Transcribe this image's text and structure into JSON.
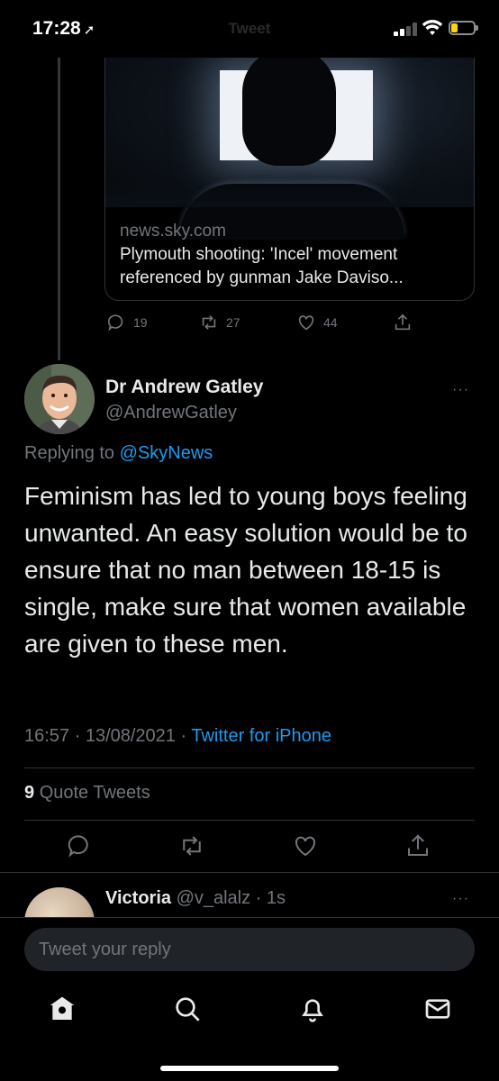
{
  "status_bar": {
    "time": "17:28",
    "location_glyph": "➚",
    "ghost_title": "Tweet",
    "battery_color": "#ffd60a"
  },
  "quoted": {
    "domain": "news.sky.com",
    "title": "Plymouth shooting: 'Incel' movement referenced by gunman Jake Daviso...",
    "replies": "19",
    "retweets": "27",
    "likes": "44"
  },
  "tweet": {
    "author_name": "Dr Andrew Gatley",
    "author_handle": "@AndrewGatley",
    "replying_prefix": "Replying to",
    "replying_to": "@SkyNews",
    "body": "Feminism has led to young boys feeling unwanted. An easy solution would be to ensure that no man between 18-15 is single, make sure that women available are given to these men.",
    "timestamp": "16:57 · 13/08/2021 ·",
    "source": "Twitter for iPhone",
    "quote_count": "9",
    "quote_label": "Quote Tweets",
    "more": "···"
  },
  "reply_preview": {
    "name": "Victoria",
    "handle_time": "@v_alalz · 1s",
    "more": "···"
  },
  "compose": {
    "placeholder": "Tweet your reply"
  },
  "tabbar": {
    "icons": [
      "home-icon",
      "search-icon",
      "bell-icon",
      "mail-icon"
    ]
  },
  "colors": {
    "accent": "#1d9bf0",
    "muted": "#71767b",
    "background": "#000000"
  }
}
